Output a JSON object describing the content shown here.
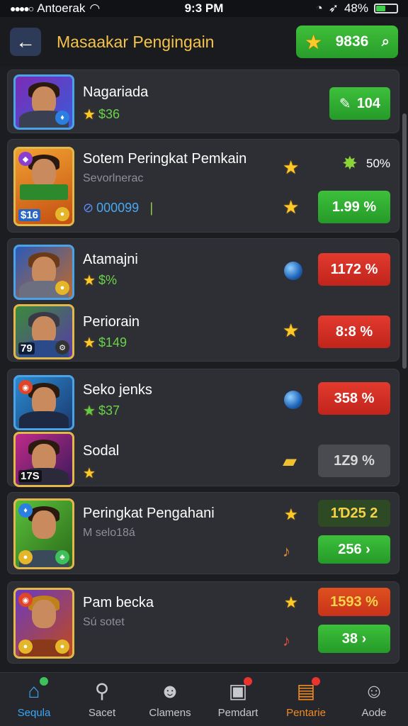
{
  "status_bar": {
    "carrier": "Antoerak",
    "time": "9:3 PM",
    "battery": "48%",
    "battery_level": 0.48
  },
  "header": {
    "title": "Masaakar Pengingain",
    "coin_value": "9836"
  },
  "players": [
    {
      "name": "Nagariada",
      "score": "$36",
      "pill": "104"
    },
    {
      "name": "Sotem Peringkat Pemkain",
      "subtitle": "Sevorlnerac",
      "avatar_badge": "$16",
      "code": "000099",
      "extra_value": "50%",
      "pill": "1.99 %"
    },
    {
      "name": "Atamajni",
      "score": "$%",
      "pill": "1172 %"
    },
    {
      "name": "Periorain",
      "avatar_badge": "79",
      "score": "$149",
      "pill": "8:8 %"
    },
    {
      "name": "Seko jenks",
      "score": "$37",
      "pill": "358 %"
    },
    {
      "name": "Sodal",
      "avatar_badge": "17S",
      "pill": "1Z9 %"
    },
    {
      "name": "Peringkat Pengahani",
      "subtitle": "M selo18á",
      "pill_top": "1Ɗ25   2",
      "pill": "256  ›"
    },
    {
      "name": "Pam becka",
      "subtitle": "Sú sotet",
      "pill_top": "1593 %",
      "pill": "38  ›"
    }
  ],
  "bottom_nav": [
    {
      "label": "Sequla"
    },
    {
      "label": "Sacet"
    },
    {
      "label": "Clamens"
    },
    {
      "label": "Pemdart"
    },
    {
      "label": "Pentarie"
    },
    {
      "label": "Aode"
    }
  ]
}
